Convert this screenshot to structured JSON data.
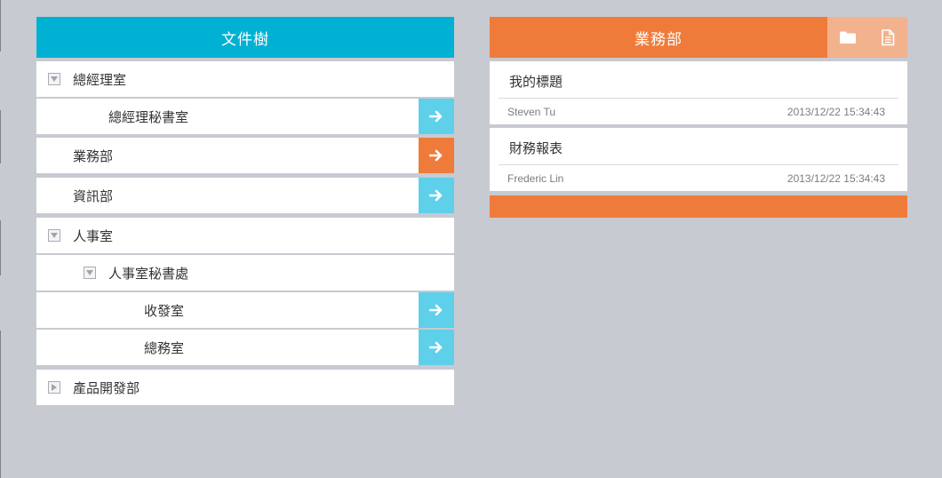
{
  "tree": {
    "title": "文件樹",
    "items": [
      {
        "label": "總經理室",
        "toggle": "expanded",
        "action": null
      },
      {
        "label": "總經理秘書室",
        "toggle": null,
        "action": "open"
      },
      {
        "label": "業務部",
        "toggle": null,
        "action": "open-active"
      },
      {
        "label": "資訊部",
        "toggle": null,
        "action": "open"
      },
      {
        "label": "人事室",
        "toggle": "expanded",
        "action": null
      },
      {
        "label": "人事室秘書處",
        "toggle": "expanded",
        "action": null
      },
      {
        "label": "收發室",
        "toggle": null,
        "action": "open"
      },
      {
        "label": "總務室",
        "toggle": null,
        "action": "open"
      },
      {
        "label": "產品開發部",
        "toggle": "collapsed",
        "action": null
      }
    ]
  },
  "docs": {
    "title": "業務部",
    "tools": [
      "folder-icon",
      "document-icon"
    ],
    "cards": [
      {
        "title": "我的標題",
        "author": "Steven Tu",
        "timestamp": "2013/12/22 15:34:43"
      },
      {
        "title": "財務報表",
        "author": "Frederic Lin",
        "timestamp": "2013/12/22 15:34:43"
      }
    ]
  },
  "colors": {
    "background": "#c7cad1",
    "tree_header": "#00b1d4",
    "doc_header": "#ef7b3b",
    "action_blue": "#5ed0ea",
    "action_orange": "#ef7b3b",
    "tool_button": "#f3b28e"
  }
}
